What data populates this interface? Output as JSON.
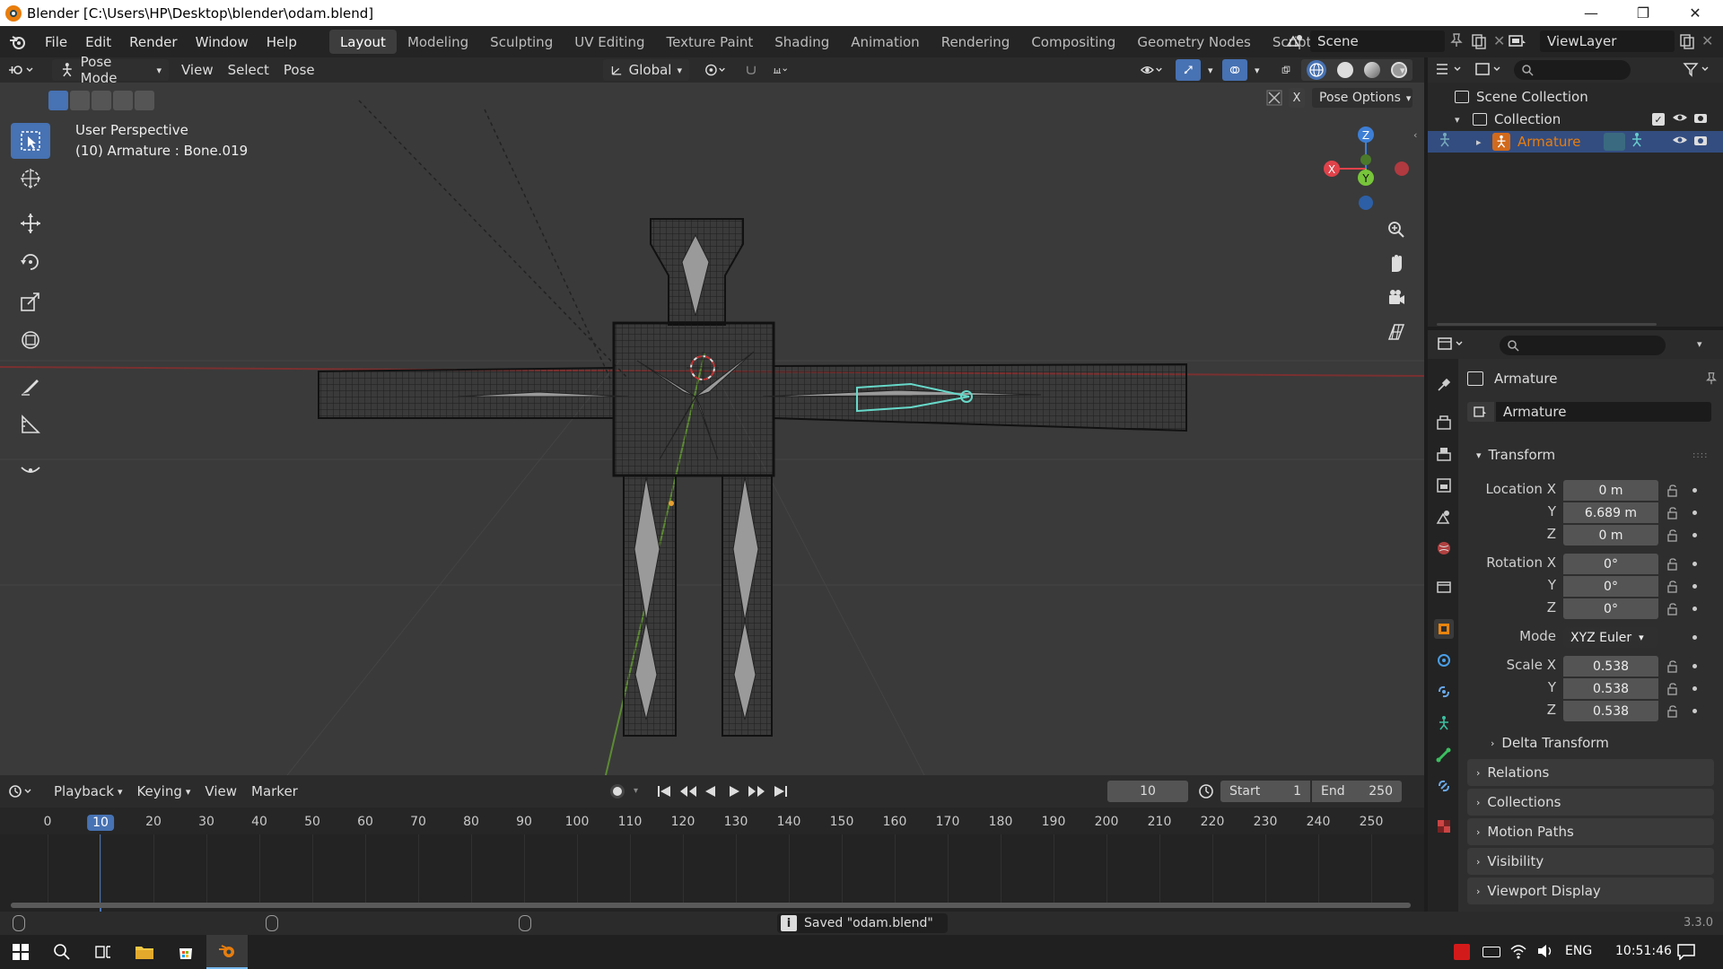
{
  "window": {
    "title": "Blender [C:\\Users\\HP\\Desktop\\blender\\odam.blend]",
    "controls": [
      "—",
      "❐",
      "✕"
    ]
  },
  "menu": {
    "items": [
      "File",
      "Edit",
      "Render",
      "Window",
      "Help"
    ]
  },
  "workspaces": {
    "tabs": [
      "Layout",
      "Modeling",
      "Sculpting",
      "UV Editing",
      "Texture Paint",
      "Shading",
      "Animation",
      "Rendering",
      "Compositing",
      "Geometry Nodes",
      "Scripting"
    ],
    "add": "+",
    "active": "Layout"
  },
  "scene": {
    "name": "Scene"
  },
  "viewlayer": {
    "name": "ViewLayer"
  },
  "viewport_header": {
    "mode": "Pose Mode",
    "menus": [
      "View",
      "Select",
      "Pose"
    ],
    "orientation": "Global",
    "pose_options": "Pose Options",
    "x_mirror": "X"
  },
  "viewport": {
    "perspective": "User Perspective",
    "object_info": "(10) Armature : Bone.019",
    "gizmo": {
      "x": "X",
      "y": "Y",
      "z": "Z"
    }
  },
  "outliner": {
    "rows": [
      {
        "label": "Scene Collection"
      },
      {
        "label": "Collection"
      },
      {
        "label": "Armature",
        "selected": true
      }
    ]
  },
  "properties": {
    "object_name": "Armature",
    "data_name": "Armature",
    "transform_title": "Transform",
    "location": {
      "label_x": "Location X",
      "x": "0 m",
      "y": "6.689 m",
      "z": "0 m"
    },
    "rotation": {
      "label_x": "Rotation X",
      "x": "0°",
      "y": "0°",
      "z": "0°"
    },
    "mode": {
      "label": "Mode",
      "value": "XYZ Euler"
    },
    "scale": {
      "label_x": "Scale X",
      "x": "0.538",
      "y": "0.538",
      "z": "0.538"
    },
    "axis_labels": {
      "y": "Y",
      "z": "Z"
    },
    "delta_transform": "Delta Transform",
    "panels": [
      "Relations",
      "Collections",
      "Motion Paths",
      "Visibility",
      "Viewport Display"
    ]
  },
  "timeline": {
    "menus": [
      "Playback",
      "Keying",
      "View",
      "Marker"
    ],
    "current_frame": "10",
    "start_label": "Start",
    "start": "1",
    "end_label": "End",
    "end": "250",
    "ticks": [
      "0",
      "10",
      "20",
      "30",
      "40",
      "50",
      "60",
      "70",
      "80",
      "90",
      "100",
      "110",
      "120",
      "130",
      "140",
      "150",
      "160",
      "170",
      "180",
      "190",
      "200",
      "210",
      "220",
      "230",
      "240",
      "250"
    ]
  },
  "status": {
    "message": "Saved \"odam.blend\"",
    "version": "3.3.0"
  },
  "taskbar": {
    "lang": "ENG",
    "time": "10:51:46"
  },
  "colors": {
    "accent": "#4772b3",
    "outliner_selected": "#334d80",
    "armature_orange": "#e87d0d",
    "x_axis": "#e0424a",
    "y_axis": "#77c53a",
    "z_axis": "#3d7fd6"
  },
  "icons": [
    "blender-logo-icon",
    "search-icon",
    "eye-icon",
    "camera-icon",
    "hand-icon",
    "zoom-icon",
    "grid-icon",
    "move-icon",
    "rotate-icon",
    "scale-icon",
    "cursor-icon",
    "select-box-icon",
    "annotate-icon",
    "measure-icon",
    "play-icon",
    "clock-icon",
    "windows-start-icon"
  ]
}
